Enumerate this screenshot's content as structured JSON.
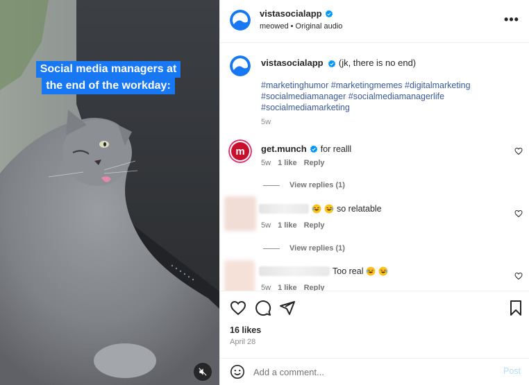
{
  "media": {
    "caption_lines": [
      "Social media managers at",
      "the end of the workday:"
    ]
  },
  "header": {
    "username": "vistasocialapp",
    "audio": "meowed • Original audio",
    "more_label": "•••"
  },
  "caption": {
    "username": "vistasocialapp",
    "text": "(jk, there is no end)",
    "hashtags": [
      "#marketinghumor #marketingmemes #digitalmarketing",
      "#socialmediamanager #socialmediamanagerlife",
      "#socialmediamarketing"
    ],
    "time": "5w"
  },
  "comments": [
    {
      "username": "get.munch",
      "text": "for realll",
      "time": "5w",
      "likes": "1 like",
      "reply": "Reply",
      "view_replies": "View replies (1)",
      "avatar_letter": "m"
    },
    {
      "username": "",
      "text": "so relatable",
      "time": "5w",
      "likes": "1 like",
      "reply": "Reply",
      "view_replies": "View replies (1)"
    },
    {
      "username": "",
      "text": "Too real",
      "time": "5w",
      "likes": "1 like",
      "reply": "Reply"
    }
  ],
  "actions": {
    "likes": "16 likes",
    "date": "April 28"
  },
  "composer": {
    "placeholder": "Add a comment...",
    "post_label": "Post"
  },
  "icons": {
    "verified": "verified-badge-icon",
    "heart": "heart-icon",
    "comment": "comment-icon",
    "share": "share-icon",
    "save": "bookmark-icon",
    "emoji": "emoji-icon",
    "mute": "muted-speaker-icon"
  },
  "colors": {
    "verified_blue": "#0095f6",
    "caption_bg": "#1877f2",
    "hashtag": "#3a53a4",
    "post_disabled": "#b2dffc"
  }
}
